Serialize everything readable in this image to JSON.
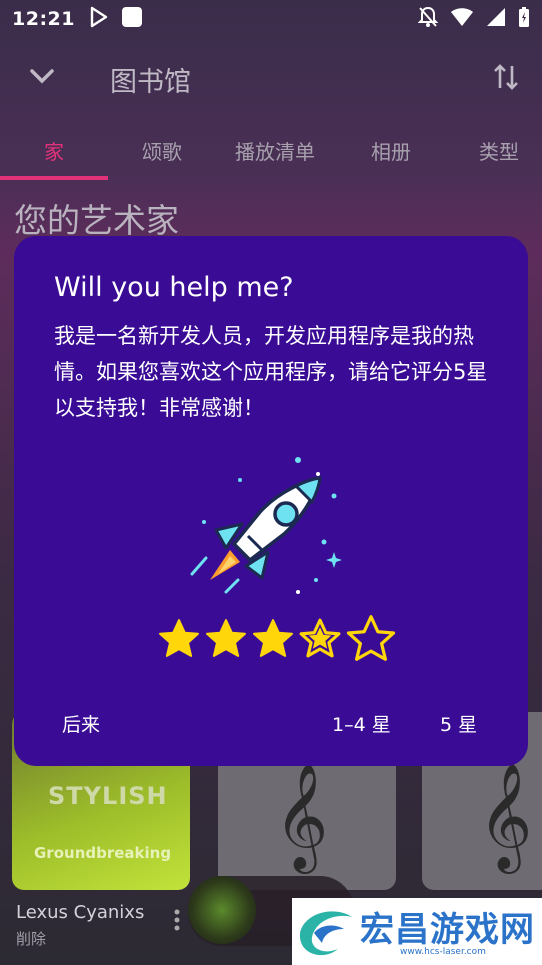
{
  "status_bar": {
    "time": "12:21"
  },
  "app_bar": {
    "title": "图书馆"
  },
  "tabs": [
    {
      "label": "家"
    },
    {
      "label": "颂歌"
    },
    {
      "label": "播放清单"
    },
    {
      "label": "相册"
    },
    {
      "label": "类型"
    }
  ],
  "section": {
    "title": "您的艺术家"
  },
  "cards": {
    "first_cover_title": "STYLISH",
    "first_cover_subtitle": "Groundbreaking"
  },
  "artist": {
    "name": "Lexus Cyanixs",
    "subtitle": "削除"
  },
  "dialog": {
    "title": "Will you help me?",
    "message": "我是一名新开发人员，开发应用程序是我的热情。如果您喜欢这个应用程序，请给它评分5星以支持我！非常感谢！",
    "rating": 3.5,
    "rating_max": 5,
    "buttons": {
      "later": "后来",
      "one_to_four": "1–4 星",
      "five": "5 星"
    }
  },
  "watermark": {
    "text": "宏昌游戏网",
    "url": "www.hcs-laser.com"
  },
  "colors": {
    "dialog_bg": "#3a0b94",
    "accent": "#e4327a",
    "star": "#ffd60a"
  }
}
